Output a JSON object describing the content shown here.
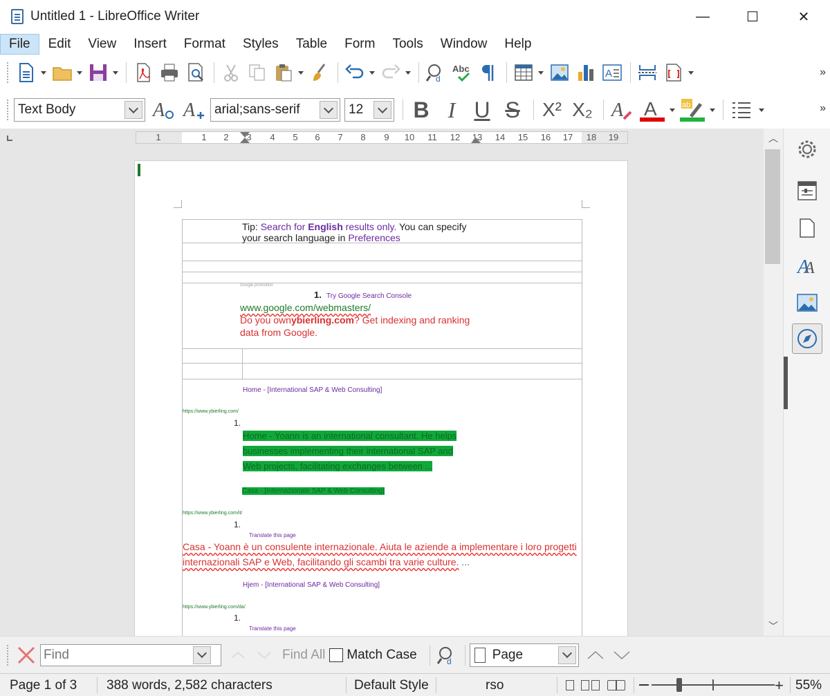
{
  "window": {
    "title": "Untitled 1 - LibreOffice Writer",
    "minimize": "—",
    "maximize": "☐",
    "close": "✕"
  },
  "menu": [
    "File",
    "Edit",
    "View",
    "Insert",
    "Format",
    "Styles",
    "Table",
    "Form",
    "Tools",
    "Window",
    "Help"
  ],
  "formatting": {
    "paragraph_style": "Text Body",
    "font_name": "arial;sans-serif",
    "font_size": "12",
    "bold": "B",
    "italic": "I",
    "underline": "U",
    "strikethrough": "S",
    "superscript": "X²",
    "subscript": "X₂"
  },
  "ruler": [
    "1",
    "1",
    "2",
    "3",
    "4",
    "5",
    "6",
    "7",
    "8",
    "9",
    "10",
    "11",
    "12",
    "13",
    "14",
    "15",
    "16",
    "17",
    "18",
    "19"
  ],
  "document": {
    "tip_prefix": "Tip:",
    "tip_link1": "Search for",
    "tip_bold": "English",
    "tip_link2": "results only.",
    "tip_rest": "You can specify",
    "tip_line2": "your search language in",
    "tip_link3": "Preferences",
    "promo_small": "Google promotion",
    "promo_num": "1.",
    "promo_title": "Try Google Search Console",
    "promo_url": "www.google.com/webmasters/",
    "promo_text1a": "Do you own",
    "promo_text1b": "ybierling.com",
    "promo_text1c": "? Get indexing and ranking",
    "promo_text2": "data from Google.",
    "r1_title": "Home - [International SAP & Web Consulting]",
    "r1_url": "https://www.ybierling.com/",
    "r1_num": "1.",
    "r1_snip1": "Home - Yoann is an international consultant. He helps",
    "r1_snip2": "businesses implementing their international SAP and",
    "r1_snip3": "Web projects, facilitating exchanges between ...",
    "r2_title": "Casa - [Internazionale SAP & Web Consulting]",
    "r2_url": "https://www.ybierling.com/it/",
    "r2_num": "1.",
    "r2_translate": "Translate this page",
    "r2_snip1": "Casa - Yoann è un consulente internazionale. Aiuta le aziende a implementare i loro progetti",
    "r2_snip2": "internazionali SAP e Web, facilitando gli scambi tra varie culture.",
    "r2_ellipsis": "...",
    "r3_title": "Hjem - [International SAP & Web Consulting]",
    "r3_url": "https://www.ybierling.com/da/",
    "r3_num": "1.",
    "r3_translate": "Translate this page"
  },
  "find": {
    "placeholder": "Find",
    "find_all": "Find All",
    "match_case": "Match Case",
    "search_type": "Page"
  },
  "status": {
    "page": "Page 1 of 3",
    "words": "388 words, 2,582 characters",
    "page_style": "Default Style",
    "language": "rso",
    "zoom": "55%"
  },
  "colors": {
    "link_purple": "#6a2aa0",
    "ad_red": "#d93030",
    "url_green": "#1f7a2a",
    "highlight_green": "#11a83a",
    "font_color_bar": "#e00000",
    "highlight_bar": "#1db33c"
  }
}
